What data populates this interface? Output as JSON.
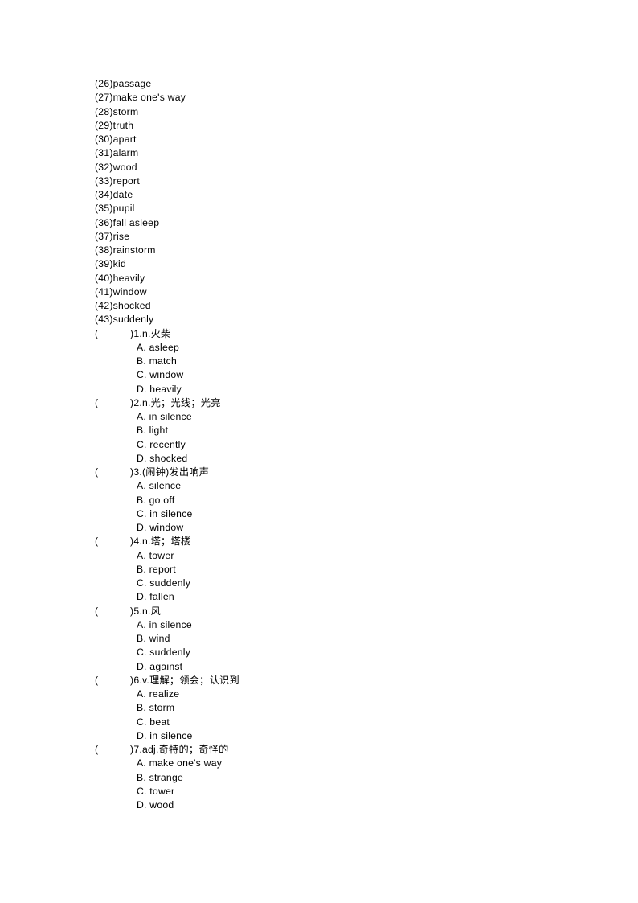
{
  "document": {
    "page_background": "#ffffff",
    "text_color": "#000000"
  },
  "word_list": [
    "(26)passage",
    "(27)make one's way",
    "(28)storm",
    "(29)truth",
    "(30)apart",
    "(31)alarm",
    "(32)wood",
    "(33)report",
    "(34)date",
    "(35)pupil",
    "(36)fall asleep",
    "(37)rise",
    "(38)rainstorm",
    "(39)kid",
    "(40)heavily",
    "(41)window",
    "(42)shocked",
    "(43)suddenly"
  ],
  "questions": [
    {
      "bracket_open": "(",
      "bracket_close": ")",
      "stem": "1.n.火柴",
      "options": [
        "A. asleep",
        "B. match",
        "C. window",
        "D. heavily"
      ]
    },
    {
      "bracket_open": "(",
      "bracket_close": ")",
      "stem": "2.n.光；光线；光亮",
      "options": [
        "A. in silence",
        "B. light",
        "C. recently",
        "D. shocked"
      ]
    },
    {
      "bracket_open": "(",
      "bracket_close": ")",
      "stem": "3.(闹钟)发出响声",
      "options": [
        "A. silence",
        "B. go off",
        "C. in silence",
        "D. window"
      ]
    },
    {
      "bracket_open": "(",
      "bracket_close": ")",
      "stem": "4.n.塔；塔楼",
      "options": [
        "A. tower",
        "B. report",
        "C. suddenly",
        "D. fallen"
      ]
    },
    {
      "bracket_open": "(",
      "bracket_close": ")",
      "stem": "5.n.风",
      "options": [
        "A. in silence",
        "B. wind",
        "C. suddenly",
        "D. against"
      ]
    },
    {
      "bracket_open": "(",
      "bracket_close": ")",
      "stem": "6.v.理解；领会；认识到",
      "options": [
        "A. realize",
        "B. storm",
        "C. beat",
        "D. in silence"
      ]
    },
    {
      "bracket_open": "(",
      "bracket_close": ")",
      "stem": "7.adj.奇特的；奇怪的",
      "options": [
        "A. make one's way",
        "B. strange",
        "C. tower",
        "D. wood"
      ]
    }
  ]
}
